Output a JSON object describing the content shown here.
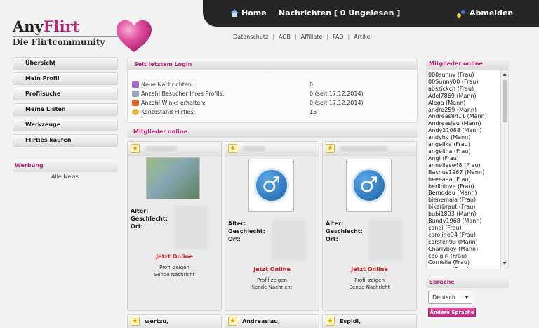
{
  "topnav": {
    "home": "Home",
    "messages": "Nachrichten [ 0 Ungelesen ]",
    "logout": "Abmelden"
  },
  "logo": {
    "part1": "Any",
    "part2": "Flirt",
    "tagline": "Die Flirtcommunity"
  },
  "footer_links": [
    "Datenschutz",
    "AGB",
    "Affiliate",
    "FAQ",
    "Artikel"
  ],
  "menu": [
    "Übersicht",
    "Mein Profil",
    "Profilsuche",
    "Meine Listen",
    "Werkzeuge",
    "Flirties kaufen"
  ],
  "werbung": {
    "title": "Werbung",
    "all_news": "Alle News"
  },
  "stats": {
    "title": "Seit letztem Login",
    "rows": [
      {
        "label": "Neue Nachrichten:",
        "value": "0",
        "icon": "envelope-icon",
        "color": "#b06ad0"
      },
      {
        "label": "Anzahl Besucher Ihres Profils:",
        "value": "0 (seit 17.12.2014)",
        "icon": "footprints-icon",
        "color": "#9aa7b8"
      },
      {
        "label": "Anzahl Winks erhalten:",
        "value": "0 (seit 17.12.2014)",
        "icon": "wink-icon",
        "color": "#e06a2a"
      },
      {
        "label": "Kontostand Flirties:",
        "value": "15",
        "icon": "coin-icon",
        "color": "#e3b53a"
      }
    ]
  },
  "online_section": {
    "title": "Mitglieder online",
    "cards": [
      {
        "avatar_type": "photo",
        "alter_label": "Alter:",
        "geschlecht_label": "Geschlecht:",
        "ort_label": "Ort:",
        "status": "Jetzt Online",
        "link1": "Profil zeigen",
        "link2": "Sende Nachricht"
      },
      {
        "avatar_type": "male",
        "alter_label": "Alter:",
        "geschlecht_label": "Geschlecht:",
        "ort_label": "Ort:",
        "status": "Jetzt Online",
        "link1": "Profil zeigen",
        "link2": "Sende Nachricht"
      },
      {
        "avatar_type": "male",
        "alter_label": "Alter:",
        "geschlecht_label": "Geschlecht:",
        "ort_label": "Ort:",
        "status": "Jetzt Online",
        "link1": "Profil zeigen",
        "link2": "Sende Nachricht"
      }
    ],
    "bottom_names": [
      "wertzu,",
      "Andreaslau,",
      "Espidi,"
    ]
  },
  "sidebar_online": {
    "title": "Mitglieder online",
    "members": [
      "000sunny (Frau)",
      "00Sunny00 (Frau)",
      "abszickch (Frau)",
      "Adel7869 (Mann)",
      "Alega (Mann)",
      "andre259 (Mann)",
      "Andreas8411 (Mann)",
      "Andreaslau (Mann)",
      "Andy21088 (Mann)",
      "andyhv (Mann)",
      "angelika (Frau)",
      "angelina (Frau)",
      "Angi (Frau)",
      "anneliese48 (Frau)",
      "Bachus1967 (Mann)",
      "beeeaaa (Frau)",
      "berlinlove (Frau)",
      "Bernddau (Mann)",
      "bienemaja (Frau)",
      "bikerbraut (Frau)",
      "bubi1803 (Mann)",
      "Bundy1968 (Mann)",
      "candi (Frau)",
      "caroline94 (Frau)",
      "carsten93 (Mann)",
      "Charlyboy (Mann)",
      "coolgirl (Frau)",
      "Cornelia (Frau)",
      "craaaaa (Frau)"
    ]
  },
  "sprache": {
    "title": "Sprache",
    "selected": "Deutsch",
    "button": "Ändere Sprache"
  }
}
